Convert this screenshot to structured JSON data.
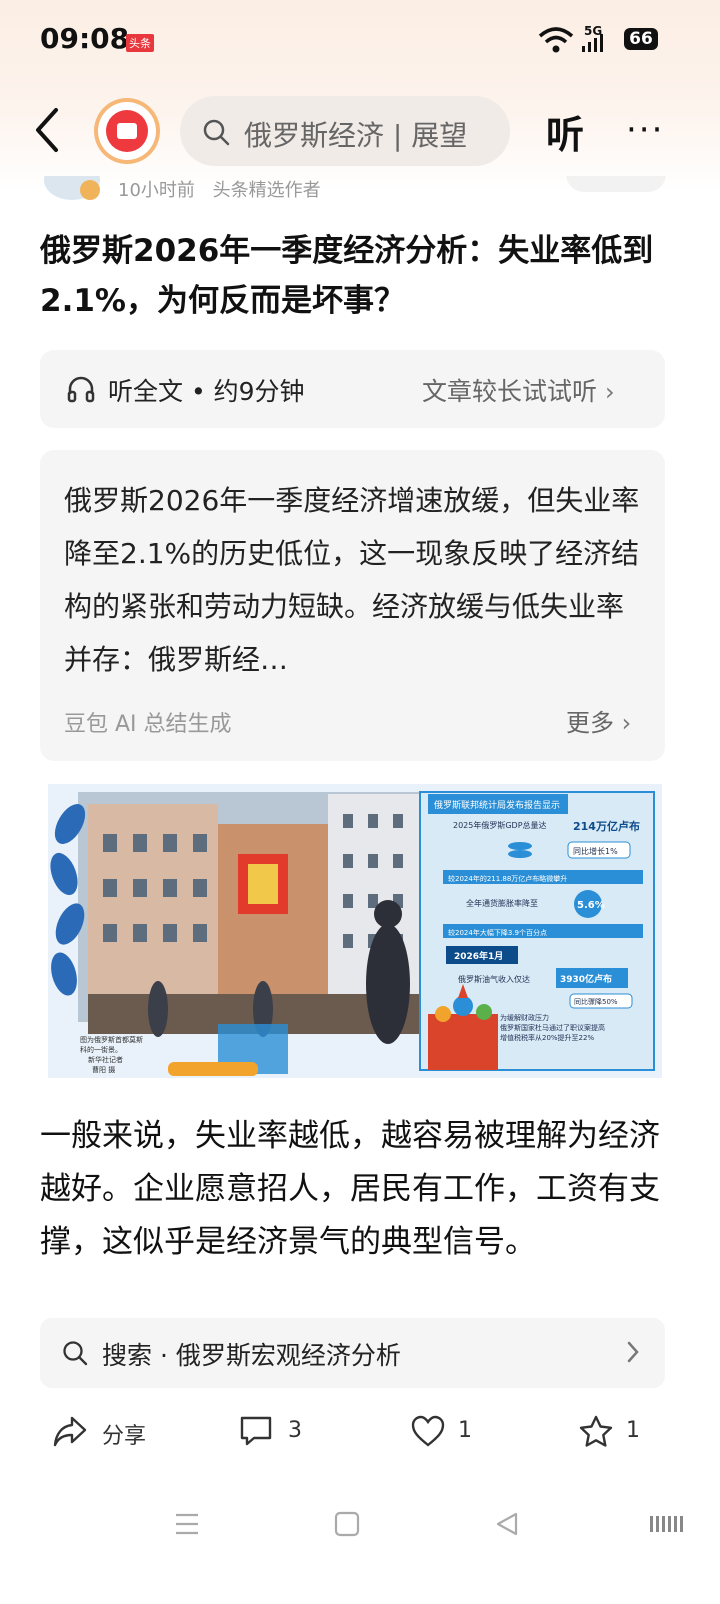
{
  "status_bar": {
    "time": "09:08",
    "app_badge": "头条",
    "network": "5G",
    "battery": "66"
  },
  "header": {
    "search_text": "俄罗斯经济 | 展望",
    "listen_label": "听",
    "more_label": "···"
  },
  "author": {
    "time_ago": "10小时前",
    "tag": "头条精选作者"
  },
  "article": {
    "title": "俄罗斯2026年一季度经济分析：失业率低到2.1%，为何反而是坏事？",
    "listen_card": {
      "left_text": "听全文 • 约9分钟",
      "right_text": "文章较长试试听"
    },
    "summary": {
      "text": "俄罗斯2026年一季度经济增速放缓，但失业率降至2.1%的历史低位，这一现象反映了经济结构的紧张和劳动力短缺。经济放缓与低失业率并存：俄罗斯经…",
      "source": "豆包 AI 总结生成",
      "more": "更多"
    },
    "figure": {
      "header": "俄罗斯联邦统计局发布报告显示",
      "line1": "2025年俄罗斯GDP总量达",
      "line1_value": "214万亿卢布",
      "line1_change": "同比增长1%",
      "line2": "较2024年的211.88万亿卢布略微攀升",
      "line3": "全年通货膨胀率降至",
      "line3_value": "5.6%",
      "line4": "较2024年大幅下降3.9个百分点",
      "date_label": "2026年1月",
      "line5": "俄罗斯油气收入仅达",
      "line5_value": "3930亿卢布",
      "line5_change": "同比骤降50%",
      "line6": "为缓解财政压力",
      "line7": "俄罗斯国家杜马通过了职议案提高",
      "line8": "增值税税率从20%提升至22%",
      "caption1": "图为俄罗斯首都莫斯",
      "caption2": "科的一街景。",
      "caption3": "新华社记者",
      "caption4": "曹阳 摄"
    },
    "body": "一般来说，失业率越低，越容易被理解为经济越好。企业愿意招人，居民有工作，工资有支撑，这似乎是经济景气的典型信号。"
  },
  "search_recommend": {
    "text": "搜索 · 俄罗斯宏观经济分析"
  },
  "actions": {
    "share_label": "分享",
    "comments_count": "3",
    "likes_count": "1",
    "favorites_count": "1"
  },
  "colors": {
    "brand_red": "#ee3a3f",
    "accent_blue": "#2a8fd6",
    "bg_card": "#f5f5f5"
  }
}
